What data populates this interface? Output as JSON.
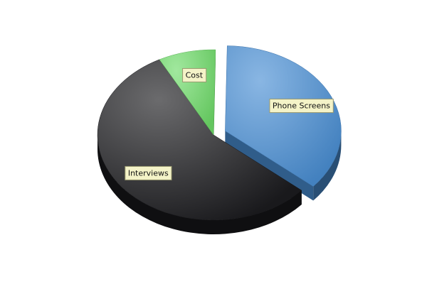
{
  "chart_data": {
    "type": "pie",
    "style": "3d-exploded",
    "legend": "none",
    "categories": [
      "Phone Screens",
      "Interviews",
      "Cost"
    ],
    "values": [
      36,
      56,
      8
    ],
    "colors": [
      "#4a8fd4",
      "#1c1c1f",
      "#6fdc6a"
    ],
    "label_background": "#f4f3c8"
  }
}
